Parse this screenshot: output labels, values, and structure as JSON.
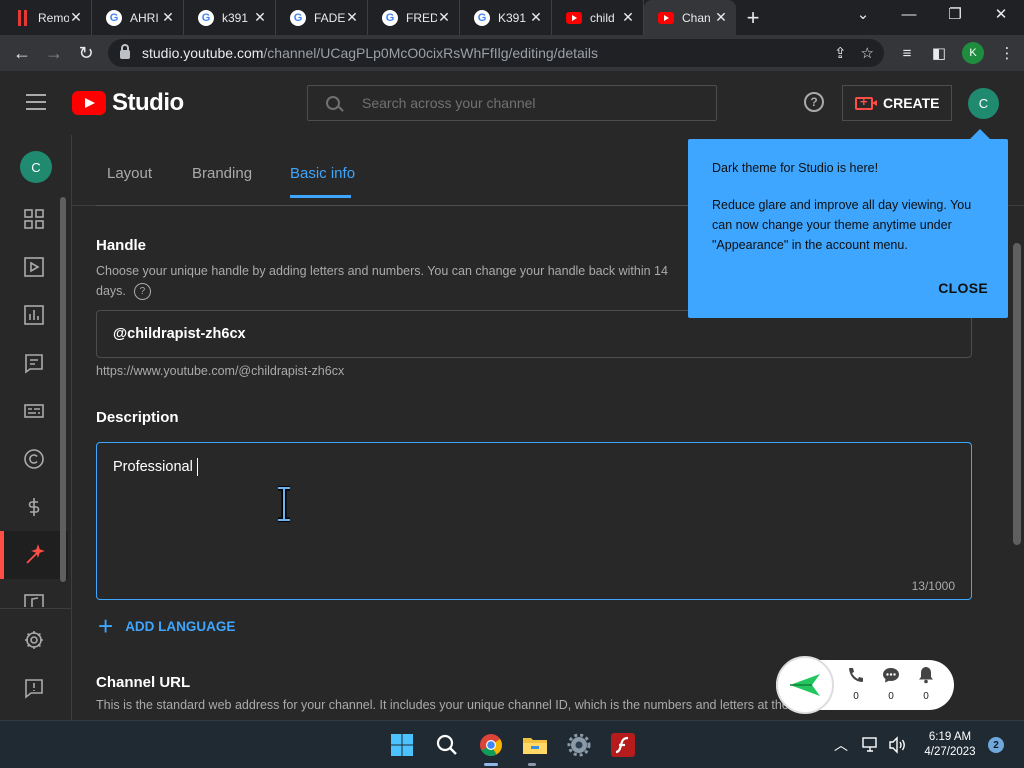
{
  "browser": {
    "tabs": [
      {
        "label": "Remo",
        "favicon": "remote-icon",
        "active": false
      },
      {
        "label": "AHRI",
        "favicon": "google-icon",
        "active": false
      },
      {
        "label": "k391",
        "favicon": "google-icon",
        "active": false
      },
      {
        "label": "FADE",
        "favicon": "google-icon",
        "active": false
      },
      {
        "label": "FRED",
        "favicon": "google-icon",
        "active": false
      },
      {
        "label": "K391",
        "favicon": "google-icon",
        "active": false
      },
      {
        "label": "child",
        "favicon": "youtube-icon",
        "active": false
      },
      {
        "label": "Chan",
        "favicon": "youtube-icon",
        "active": true
      }
    ],
    "url_host": "studio.youtube.com",
    "url_path": "/channel/UCagPLp0McO0cixRsWhFfIlg/editing/details",
    "profile_initial": "K"
  },
  "header": {
    "logo_text": "Studio",
    "search_placeholder": "Search across your channel",
    "create_label": "CREATE",
    "avatar_initial": "C"
  },
  "sidebar": {
    "avatar_initial": "C",
    "items": [
      {
        "name": "dashboard-icon",
        "active": false
      },
      {
        "name": "content-icon",
        "active": false
      },
      {
        "name": "analytics-icon",
        "active": false
      },
      {
        "name": "comments-icon",
        "active": false
      },
      {
        "name": "subtitles-icon",
        "active": false
      },
      {
        "name": "copyright-icon",
        "active": false
      },
      {
        "name": "earn-icon",
        "active": false
      },
      {
        "name": "customization-icon",
        "active": true
      },
      {
        "name": "audio-library-icon",
        "active": false
      }
    ],
    "bottom": [
      {
        "name": "settings-icon"
      },
      {
        "name": "feedback-icon"
      }
    ]
  },
  "content": {
    "tabs": [
      {
        "label": "Layout",
        "active": false
      },
      {
        "label": "Branding",
        "active": false
      },
      {
        "label": "Basic info",
        "active": true
      }
    ],
    "handle": {
      "title": "Handle",
      "desc_line1": "Choose your unique handle by adding letters and numbers. You can change your handle back within 14",
      "desc_line2": "days.",
      "value": "@childrapist-zh6cx",
      "url": "https://www.youtube.com/@childrapist-zh6cx"
    },
    "description": {
      "title": "Description",
      "value": "Professional",
      "counter": "13/1000"
    },
    "add_language": "ADD LANGUAGE",
    "channel_url": {
      "title": "Channel URL",
      "desc": "This is the standard web address for your channel. It includes your unique channel ID, which is the numbers and letters at the end of the URL."
    }
  },
  "tooltip": {
    "title": "Dark theme for Studio is here!",
    "body": "Reduce glare and improve all day viewing. You can now change your theme anytime under \"Appearance\" in the account menu.",
    "close": "CLOSE"
  },
  "widget": {
    "stats": [
      {
        "name": "calls-icon",
        "count": "0"
      },
      {
        "name": "chat-icon",
        "count": "0"
      },
      {
        "name": "bell-icon",
        "count": "0"
      }
    ]
  },
  "taskbar": {
    "time": "6:19 AM",
    "date": "4/27/2023",
    "notification_count": "2"
  },
  "colors": {
    "accent": "#3ea6ff",
    "brand_red": "#ff0000",
    "background": "#282828",
    "avatar": "#1f8a70"
  }
}
